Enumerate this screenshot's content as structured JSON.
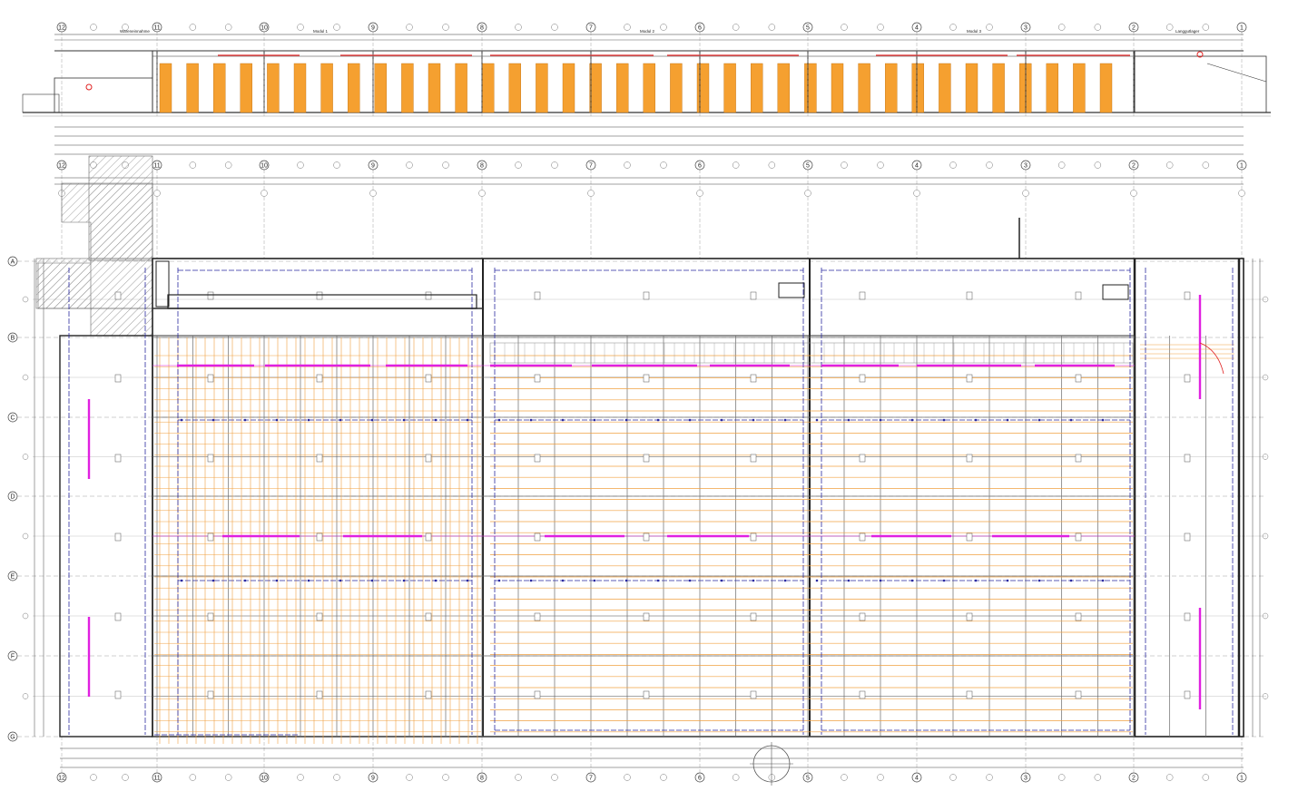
{
  "colors": {
    "line": "#333333",
    "grid": "#6a6a6a",
    "orange": "#f0a040",
    "orange_fill": "#f5a030",
    "magenta": "#e020e0",
    "blue": "#2a2aa0",
    "red": "#e02020",
    "hatch": "#777777"
  },
  "section": {
    "labels": [
      "Wareneinnahme",
      "Modul 1",
      "Modul 2",
      "Modul 3",
      "Langgutlager"
    ]
  },
  "axes": {
    "top_numbers": [
      "12",
      "11",
      "10",
      "9",
      "8",
      "7",
      "6",
      "5",
      "4",
      "3",
      "2",
      "1"
    ],
    "bottom_numbers": [
      "12",
      "11",
      "10",
      "9",
      "8",
      "7",
      "6",
      "5",
      "4",
      "3",
      "2",
      "1"
    ],
    "side_letters": [
      "A",
      "B",
      "C",
      "D",
      "E",
      "F",
      "G"
    ]
  },
  "icons": {
    "north_arrow": "north-arrow-icon",
    "section_marker": "section-marker-icon"
  }
}
